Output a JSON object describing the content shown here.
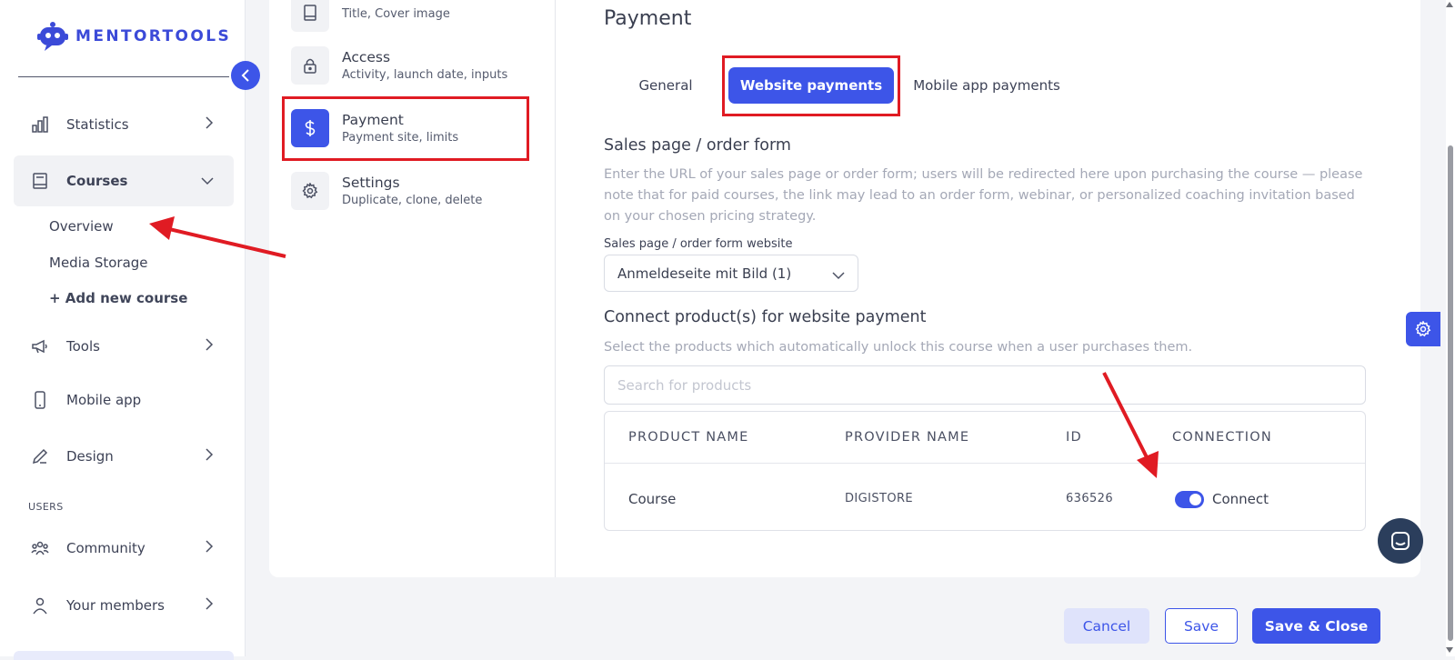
{
  "app": {
    "logo_text": "MENTORTOOLS"
  },
  "sidebar": {
    "items": [
      {
        "label": "Statistics",
        "icon": "bar-chart-icon"
      },
      {
        "label": "Courses",
        "icon": "book-icon"
      },
      {
        "label": "Tools",
        "icon": "megaphone-icon"
      },
      {
        "label": "Mobile app",
        "icon": "phone-icon"
      },
      {
        "label": "Design",
        "icon": "pencil-icon"
      },
      {
        "label": "Community",
        "icon": "users-icon"
      },
      {
        "label": "Your members",
        "icon": "user-icon"
      }
    ],
    "course_sub": [
      "Overview",
      "Media Storage",
      "+ Add new course"
    ],
    "section_users": "USERS"
  },
  "steps": [
    {
      "title": "",
      "desc": "Title, Cover image"
    },
    {
      "title": "Access",
      "desc": "Activity, launch date, inputs"
    },
    {
      "title": "Payment",
      "desc": "Payment site, limits"
    },
    {
      "title": "Settings",
      "desc": "Duplicate, clone, delete"
    }
  ],
  "main": {
    "heading": "Payment",
    "tabs": [
      "General",
      "Website payments",
      "Mobile app payments"
    ],
    "active_tab": "Website payments",
    "sales": {
      "title": "Sales page / order form",
      "desc": "Enter the URL of your sales page or order form; users will be redirected here upon purchasing the course — please note that for paid courses, the link may lead to an order form, webinar, or personalized coaching invitation based on your chosen pricing strategy.",
      "field_label": "Sales page / order form website",
      "selected": "Anmeldeseite mit Bild (1)"
    },
    "connect": {
      "title": "Connect product(s) for website payment",
      "desc": "Select the products which automatically unlock this course when a user purchases them.",
      "search_placeholder": "Search for products",
      "columns": [
        "PRODUCT NAME",
        "PROVIDER NAME",
        "ID",
        "CONNECTION"
      ],
      "rows": [
        {
          "product": "Course",
          "provider": "DIGISTORE",
          "id": "636526",
          "connection": "Connect",
          "connected": true
        }
      ]
    }
  },
  "footer": {
    "cancel": "Cancel",
    "save": "Save",
    "save_close": "Save & Close"
  },
  "colors": {
    "accent": "#3d55e8",
    "annotation": "#e01b23"
  }
}
